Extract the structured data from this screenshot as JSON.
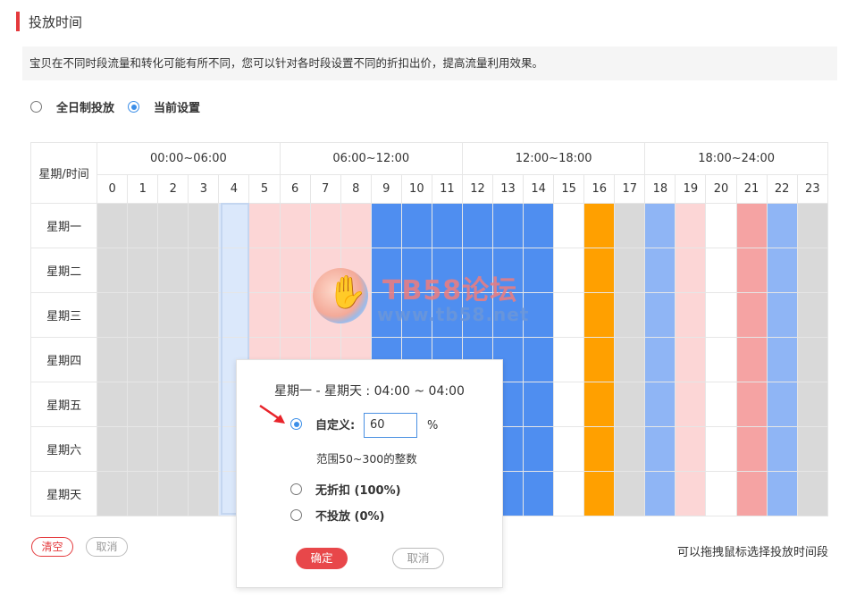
{
  "section_title": "投放时间",
  "notice": "宝贝在不同时段流量和转化可能有所不同，您可以针对各时段设置不同的折扣出价，提高流量利用效果。",
  "mode": {
    "options": [
      {
        "label": "全日制投放",
        "selected": false
      },
      {
        "label": "当前设置",
        "selected": true
      }
    ]
  },
  "grid": {
    "corner_label": "星期/时间",
    "ranges": [
      "00:00~06:00",
      "06:00~12:00",
      "12:00~18:00",
      "18:00~24:00"
    ],
    "hours": [
      "0",
      "1",
      "2",
      "3",
      "4",
      "5",
      "6",
      "7",
      "8",
      "9",
      "10",
      "11",
      "12",
      "13",
      "14",
      "15",
      "16",
      "17",
      "18",
      "19",
      "20",
      "21",
      "22",
      "23"
    ],
    "days": [
      "星期一",
      "星期二",
      "星期三",
      "星期四",
      "星期五",
      "星期六",
      "星期天"
    ],
    "hour_colors": [
      "gray",
      "gray",
      "gray",
      "gray",
      "selected",
      "light-pink",
      "light-pink",
      "light-pink",
      "light-pink",
      "blue",
      "blue",
      "blue",
      "blue",
      "blue",
      "blue",
      "white",
      "orange",
      "gray",
      "light-blue",
      "light-pink",
      "white",
      "pink",
      "light-blue",
      "gray"
    ],
    "palette": {
      "gray": "#d9d9d9",
      "light-pink": "#fcd6d6",
      "blue": "#4f8ef0",
      "white": "#ffffff",
      "orange": "#ffa000",
      "light-blue": "#8fb5f5",
      "pink": "#f5a3a3",
      "selected": "#dbe8fb"
    }
  },
  "watermark": {
    "title": "TB58论坛",
    "url": "www.tb58.net"
  },
  "buttons": {
    "clear": "清空",
    "cancel": "取消"
  },
  "hint": "可以拖拽鼠标选择投放时间段",
  "popup": {
    "title": "星期一 - 星期天 : 04:00 ~ 04:00",
    "custom_label": "自定义:",
    "custom_value": "60",
    "percent_sign": "%",
    "range_hint": "范围50~300的整数",
    "no_discount_label": "无折扣 (100%)",
    "no_delivery_label": "不投放 (0%)",
    "ok": "确定",
    "cancel": "取消"
  }
}
